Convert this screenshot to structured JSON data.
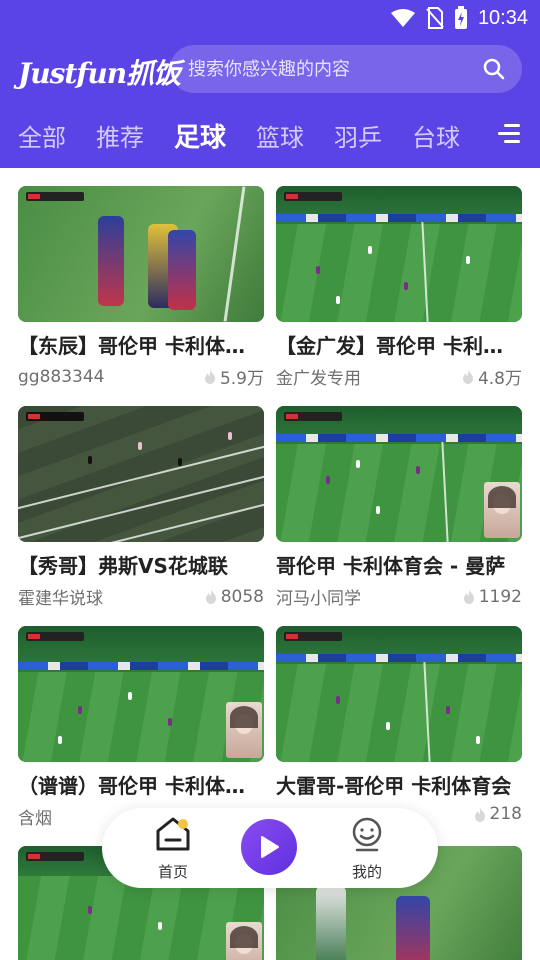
{
  "status": {
    "time": "10:34"
  },
  "app": {
    "logo": "Justfun抓饭"
  },
  "search": {
    "placeholder": "搜索你感兴趣的内容"
  },
  "tabs": [
    {
      "label": "全部"
    },
    {
      "label": "推荐"
    },
    {
      "label": "足球"
    },
    {
      "label": "篮球"
    },
    {
      "label": "羽乒"
    },
    {
      "label": "台球"
    }
  ],
  "active_tab": "足球",
  "videos": [
    {
      "title": "【东辰】哥伦甲 卡利体育会 - 曼",
      "author": "gg883344",
      "views": "5.9万"
    },
    {
      "title": "【金广发】哥伦甲 卡利体育会",
      "author": "金广发专用",
      "views": "4.8万"
    },
    {
      "title": "【秀哥】弗斯VS花城联",
      "author": "霍建华说球",
      "views": "8058"
    },
    {
      "title": "哥伦甲 卡利体育会 - 曼萨",
      "author": "河马小同学",
      "views": "1192"
    },
    {
      "title": "（谱谱）哥伦甲 卡利体育会",
      "author": "含烟",
      "views": ""
    },
    {
      "title": "大雷哥-哥伦甲  卡利体育会",
      "author": "",
      "views": "218"
    },
    {
      "title": "",
      "author": "",
      "views": ""
    },
    {
      "title": "",
      "author": "",
      "views": ""
    }
  ],
  "nav": {
    "home_label": "首页",
    "mine_label": "我的"
  },
  "colors": {
    "brand": "#5b44e6",
    "play_button": "#6b38e8"
  },
  "icons": [
    "wifi-icon",
    "no-sim-icon",
    "battery-charging-icon",
    "search-icon",
    "menu-icon",
    "flame-icon",
    "home-icon",
    "play-icon",
    "user-icon"
  ]
}
